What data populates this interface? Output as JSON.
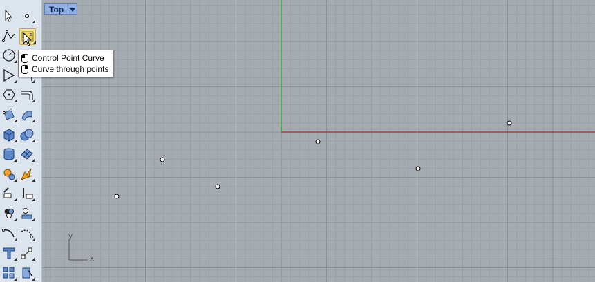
{
  "viewport": {
    "name": "Top",
    "colors": {
      "background": "#a6abb2",
      "minor_grid": "#9aa0a7",
      "major_grid": "#8b9198",
      "x_axis": "#b23a3a",
      "y_axis": "#2eaa3c"
    }
  },
  "tooltip": {
    "items": [
      {
        "label": "Control Point Curve",
        "icon": "mouse-left-icon"
      },
      {
        "label": "Curve through points",
        "icon": "mouse-right-icon"
      }
    ]
  },
  "axis_widget": {
    "x": "x",
    "y": "y"
  },
  "toolbar": {
    "tools": [
      "select-arrow-icon",
      "point-icon",
      "polyline-icon",
      "control-point-curve-icon",
      "circle-icon",
      "arc-icon",
      "polygon-icon",
      "fillet-icon",
      "hexagon-icon",
      "offset-curve-icon",
      "surface-from-points-icon",
      "extrude-icon",
      "box-icon",
      "boolean-union-icon",
      "cylinder-icon",
      "mesh-icon",
      "transform-gear-icon",
      "explode-icon",
      "split-icon",
      "trim-icon",
      "group-icon",
      "analyze-icon",
      "curve-tools-icon",
      "curve-edit-icon",
      "text-icon",
      "dimension-icon",
      "array-icon",
      "render-icon"
    ]
  }
}
